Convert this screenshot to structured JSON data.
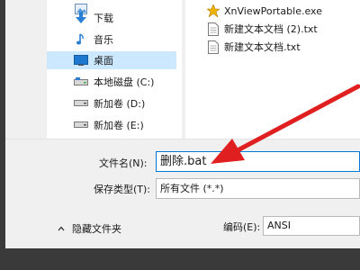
{
  "nav": {
    "items": [
      {
        "label": "",
        "icon": "pictures-icon"
      },
      {
        "label": "下载",
        "icon": "download-arrow-icon"
      },
      {
        "label": "音乐",
        "icon": "music-note-icon"
      },
      {
        "label": "桌面",
        "icon": "desktop-icon",
        "selected": true
      },
      {
        "label": "本地磁盘 (C:)",
        "icon": "drive-icon"
      },
      {
        "label": "新加卷 (D:)",
        "icon": "drive-icon"
      },
      {
        "label": "新加卷 (E:)",
        "icon": "drive-icon"
      }
    ]
  },
  "files": [
    {
      "name": "XnViewPortable.exe",
      "icon": "exe-file-icon"
    },
    {
      "name": "新建文本文档 (2).txt",
      "icon": "text-file-icon"
    },
    {
      "name": "新建文本文档.txt",
      "icon": "text-file-icon"
    }
  ],
  "form": {
    "filename_label": "文件名(N):",
    "filename_value": "删除.bat",
    "filetype_label": "保存类型(T):",
    "filetype_value": "所有文件  (*.*)",
    "hide_folders_label": "隐藏文件夹",
    "encoding_label": "编码(E):",
    "encoding_value": "ANSI"
  },
  "colors": {
    "accent": "#0078d7",
    "selection": "#cce8ff",
    "annotation_arrow": "#e02020"
  }
}
